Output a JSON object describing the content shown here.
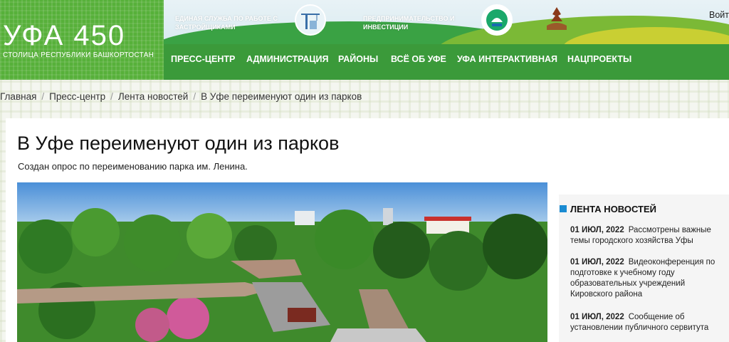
{
  "header": {
    "logo_title": "УФА 450",
    "logo_subtitle": "СТОЛИЦА РЕСПУБЛИКИ БАШКОРТОСТАН",
    "promo_1": "ЕДИНАЯ СЛУЖБА ПО РАБОТЕ С ЗАСТРОЙЩИКАМИ",
    "promo_2": "ПРЕДПРИНИМАТЕЛЬСТВО И ИНВЕСТИЦИИ",
    "nav": [
      "ПРЕСС-ЦЕНТР",
      "АДМИНИСТРАЦИЯ",
      "РАЙОНЫ",
      "ВСЁ ОБ УФЕ",
      "УФА ИНТЕРАКТИВНАЯ",
      "НАЦПРОЕКТЫ"
    ],
    "login": "Войт",
    "colors": {
      "green_dark": "#3b9a3a",
      "green_logo": "#57b03a"
    }
  },
  "breadcrumb": [
    "Главная",
    "Пресс-центр",
    "Лента новостей",
    "В Уфе переименуют один из парков"
  ],
  "article": {
    "title": "В Уфе переименуют один из парков",
    "subtitle": "Создан опрос по переименованию парка им. Ленина."
  },
  "sidebar": {
    "heading": "ЛЕНТА НОВОСТЕЙ",
    "accent": "#1a8bd2",
    "news": [
      {
        "date": "01 ИЮЛ, 2022",
        "text": "Рассмотрены важные темы городского хозяйства Уфы"
      },
      {
        "date": "01 ИЮЛ, 2022",
        "text": "Видеоконференция по подготовке к учебному году образовательных учреждений Кировского района"
      },
      {
        "date": "01 ИЮЛ, 2022",
        "text": "Сообщение об установлении публичного сервитута"
      }
    ]
  }
}
